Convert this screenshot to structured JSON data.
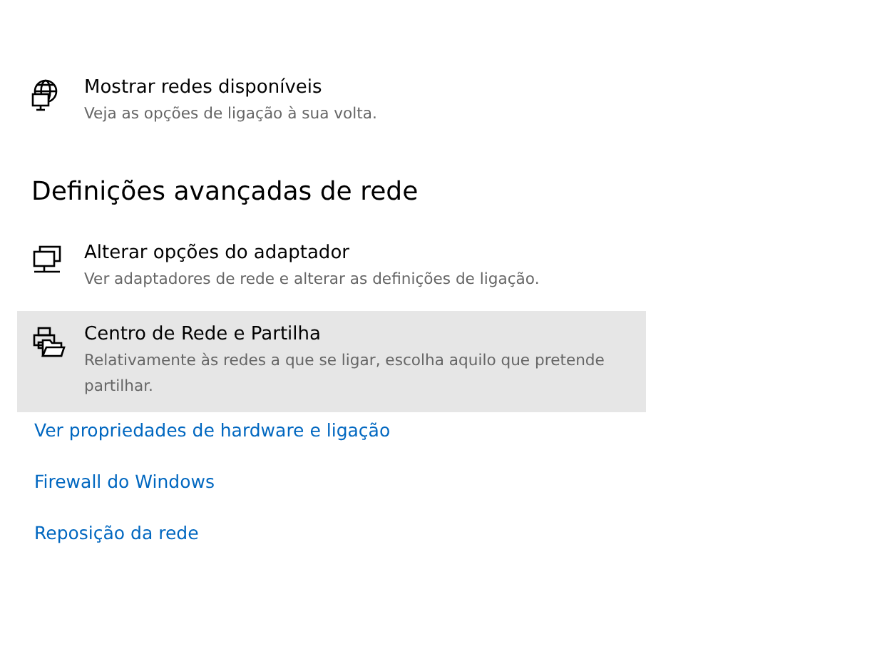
{
  "top_items": [
    {
      "kind": "globe",
      "title": "Mostrar redes disponíveis",
      "description": "Veja as opções de ligação à sua volta.",
      "selected": false
    }
  ],
  "section": {
    "heading": "Definições avançadas de rede",
    "items": [
      {
        "kind": "monitors",
        "title": "Alterar opções do adaptador",
        "description": "Ver adaptadores de rede e alterar as definições de ligação.",
        "selected": false
      },
      {
        "kind": "sharing",
        "title": "Centro de Rede e Partilha",
        "description": "Relativamente às redes a que se ligar, escolha aquilo que pretende partilhar.",
        "selected": true
      }
    ]
  },
  "links": [
    "Ver propriedades de hardware e ligação",
    "Firewall do Windows",
    "Reposição da rede"
  ]
}
